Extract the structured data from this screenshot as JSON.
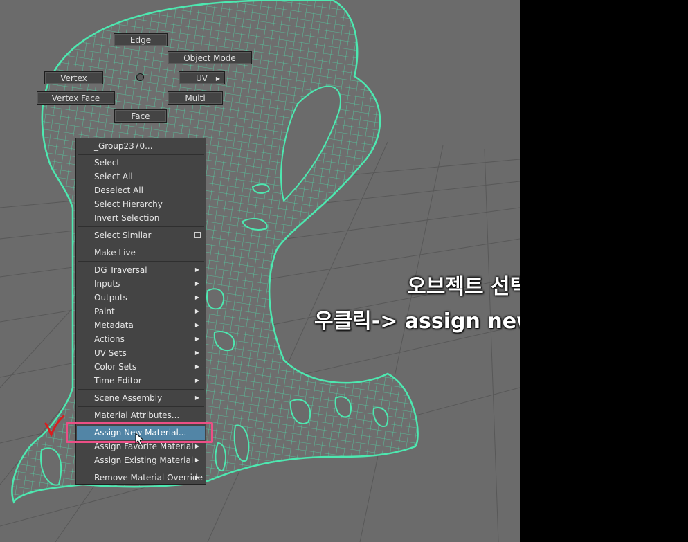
{
  "marking_menu": {
    "edge": "Edge",
    "object_mode": "Object Mode",
    "vertex": "Vertex",
    "uv": "UV",
    "vertex_face": "Vertex Face",
    "multi": "Multi",
    "face": "Face"
  },
  "context_menu": {
    "object_name": "_Group2370...",
    "items": [
      "Select",
      "Select All",
      "Deselect All",
      "Select Hierarchy",
      "Invert Selection",
      "Select Similar",
      "Make Live",
      "DG Traversal",
      "Inputs",
      "Outputs",
      "Paint",
      "Metadata",
      "Actions",
      "UV Sets",
      "Color Sets",
      "Time Editor",
      "Scene Assembly",
      "Material Attributes...",
      "Assign New Material...",
      "Assign Favorite Material",
      "Assign Existing Material",
      "Remove Material Override"
    ],
    "highlighted_item": "Assign New Material..."
  },
  "caption": {
    "line1": "오브젝트 선택후",
    "line2": "우클릭-> assign new material"
  },
  "colors": {
    "viewport_bg": "#6b6b6b",
    "mesh_wire": "#4de8b0",
    "menu_bg": "#444444",
    "menu_highlight": "#5285a6",
    "annotation_box": "#ec4f86",
    "check_mark": "#d81e1e"
  },
  "icons": {
    "cursor": "mouse-pointer-icon",
    "check": "check-mark-icon",
    "submenu": "submenu-arrow-icon",
    "option_box": "option-box-icon"
  }
}
